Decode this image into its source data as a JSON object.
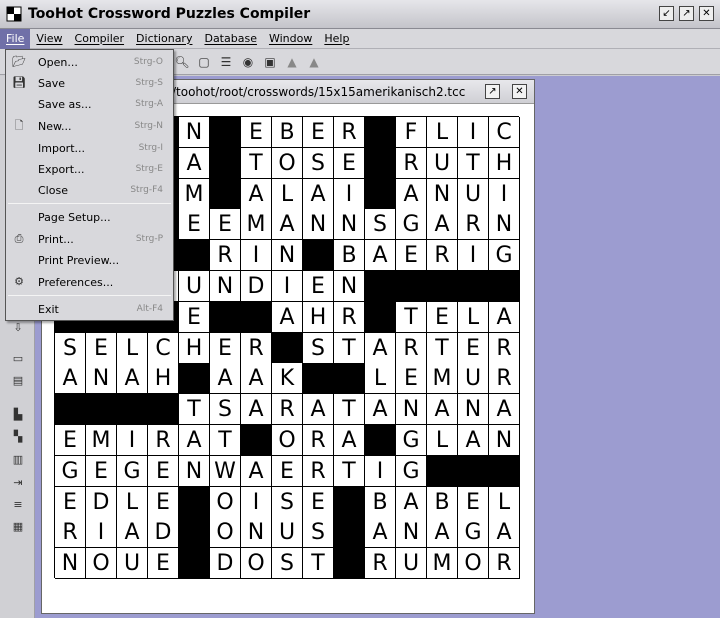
{
  "window": {
    "title": "TooHot Crossword Puzzles Compiler"
  },
  "menubar": [
    "File",
    "View",
    "Compiler",
    "Dictionary",
    "Database",
    "Window",
    "Help"
  ],
  "file_menu": {
    "items": [
      {
        "label": "Open...",
        "shortcut": "Strg-O",
        "icon": "open-folder-icon"
      },
      {
        "label": "Save",
        "shortcut": "Strg-S",
        "icon": "save-disk-icon"
      },
      {
        "label": "Save as...",
        "shortcut": "Strg-A",
        "icon": ""
      },
      {
        "label": "New...",
        "shortcut": "Strg-N",
        "icon": "new-document-icon"
      },
      {
        "label": "Import...",
        "shortcut": "Strg-I",
        "icon": ""
      },
      {
        "label": "Export...",
        "shortcut": "Strg-E",
        "icon": ""
      },
      {
        "label": "Close",
        "shortcut": "Strg-F4",
        "icon": ""
      },
      {
        "label": "Page Setup...",
        "shortcut": "",
        "icon": ""
      },
      {
        "label": "Print...",
        "shortcut": "Strg-P",
        "icon": "printer-icon"
      },
      {
        "label": "Print Preview...",
        "shortcut": "",
        "icon": ""
      },
      {
        "label": "Preferences...",
        "shortcut": "",
        "icon": "preferences-icon"
      },
      {
        "label": "Exit",
        "shortcut": "Alt-F4",
        "icon": ""
      }
    ]
  },
  "document": {
    "path": "/toohot/root/crosswords/15x15amerikanisch2.tcc"
  },
  "crossword": {
    "rows": [
      "#N#EBER#FLIC",
      "#A#TOSE#RUTH",
      "#M#ALAI#ANUI",
      "#EEMANNSGARN",
      "##RIN#BAERIG",
      "#FUNDIEN#####",
      "#E##AHR#TELA",
      "SELCHER#STARTER",
      "ANAH#AAK##LEMUR",
      "####TSARATANANA",
      "EMIRAT#ORA#GLAN",
      "GEGENWAERTIG###",
      "EDLE#OISE#BABEL",
      "RIAD#ONUS#ANAGA",
      "NOUE#DOST#RUMOR"
    ]
  },
  "colors": {
    "desktop": "#9c9cd0",
    "menu_highlight": "#7070a8"
  }
}
